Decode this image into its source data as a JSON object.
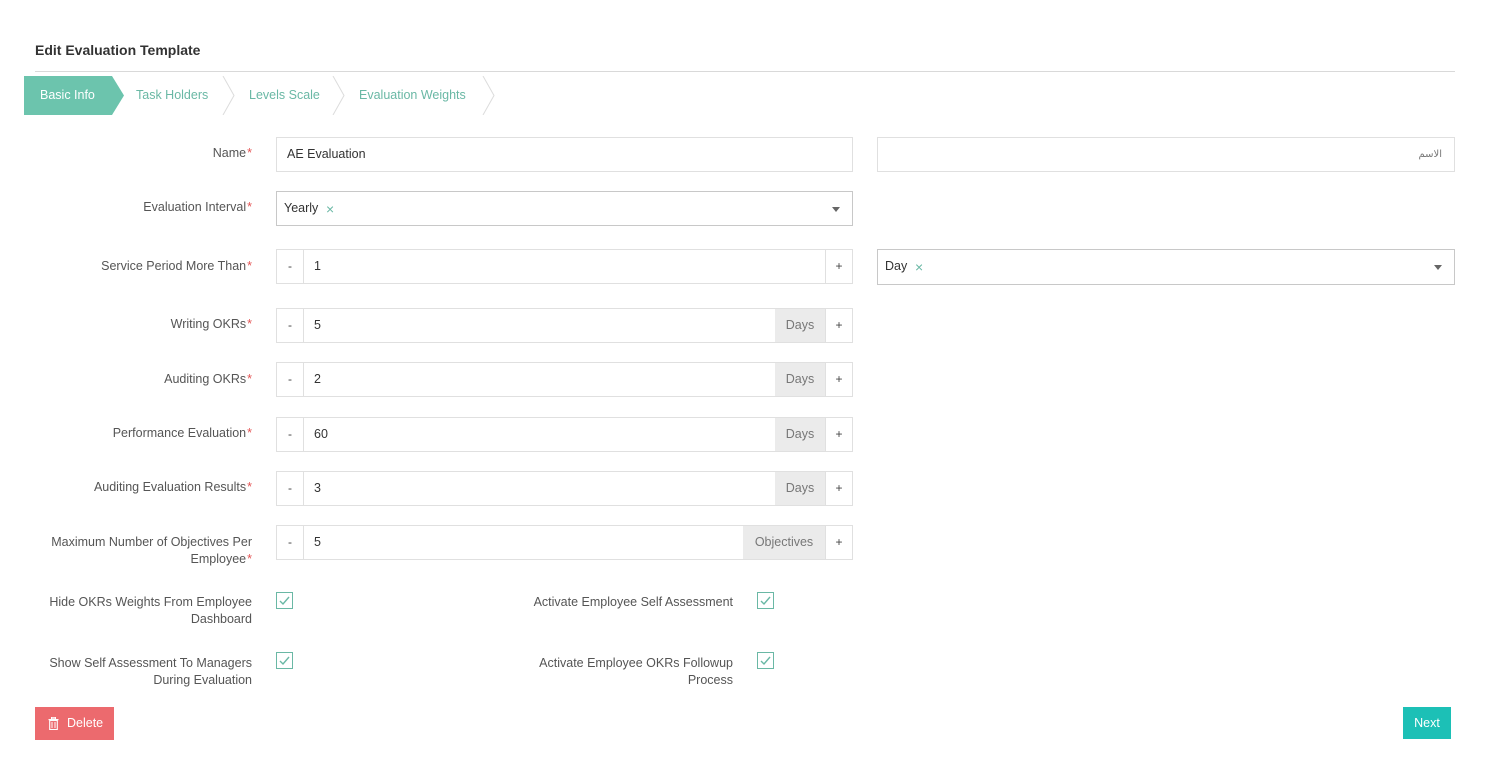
{
  "page": {
    "title": "Edit Evaluation Template"
  },
  "steps": [
    {
      "label": "Basic Info",
      "active": true
    },
    {
      "label": "Task Holders",
      "active": false
    },
    {
      "label": "Levels Scale",
      "active": false
    },
    {
      "label": "Evaluation Weights",
      "active": false
    }
  ],
  "form": {
    "name": {
      "label": "Name",
      "value": "AE Evaluation",
      "arabic_placeholder": "الاسم"
    },
    "interval": {
      "label": "Evaluation Interval",
      "value": "Yearly"
    },
    "service_period": {
      "label": "Service Period More Than",
      "value": "1",
      "unit": "Day"
    },
    "writing_okrs": {
      "label": "Writing OKRs",
      "value": "5",
      "unit": "Days"
    },
    "auditing_okrs": {
      "label": "Auditing OKRs",
      "value": "2",
      "unit": "Days"
    },
    "performance_evaluation": {
      "label": "Performance Evaluation",
      "value": "60",
      "unit": "Days"
    },
    "auditing_results": {
      "label": "Auditing Evaluation Results",
      "value": "3",
      "unit": "Days"
    },
    "max_objectives": {
      "label_line1": "Maximum Number of Objectives Per",
      "label_line2": "Employee",
      "value": "5",
      "unit": "Objectives"
    },
    "stepper_minus": "-",
    "stepper_plus": "+",
    "required_mark": "*"
  },
  "checkboxes": {
    "hide_weights": {
      "label_line1": "Hide OKRs Weights From Employee",
      "label_line2": "Dashboard",
      "checked": true
    },
    "self_assessment": {
      "label": "Activate Employee Self Assessment",
      "checked": true
    },
    "show_self_assessment": {
      "label_line1": "Show Self Assessment To Managers",
      "label_line2": "During Evaluation",
      "checked": true
    },
    "okrs_followup": {
      "label_line1": "Activate Employee OKRs Followup",
      "label_line2": "Process",
      "checked": true
    }
  },
  "actions": {
    "delete": "Delete",
    "next": "Next"
  },
  "colors": {
    "accent": "#6cc4ad",
    "danger": "#ec6a6e",
    "primary": "#1cc0b6"
  }
}
